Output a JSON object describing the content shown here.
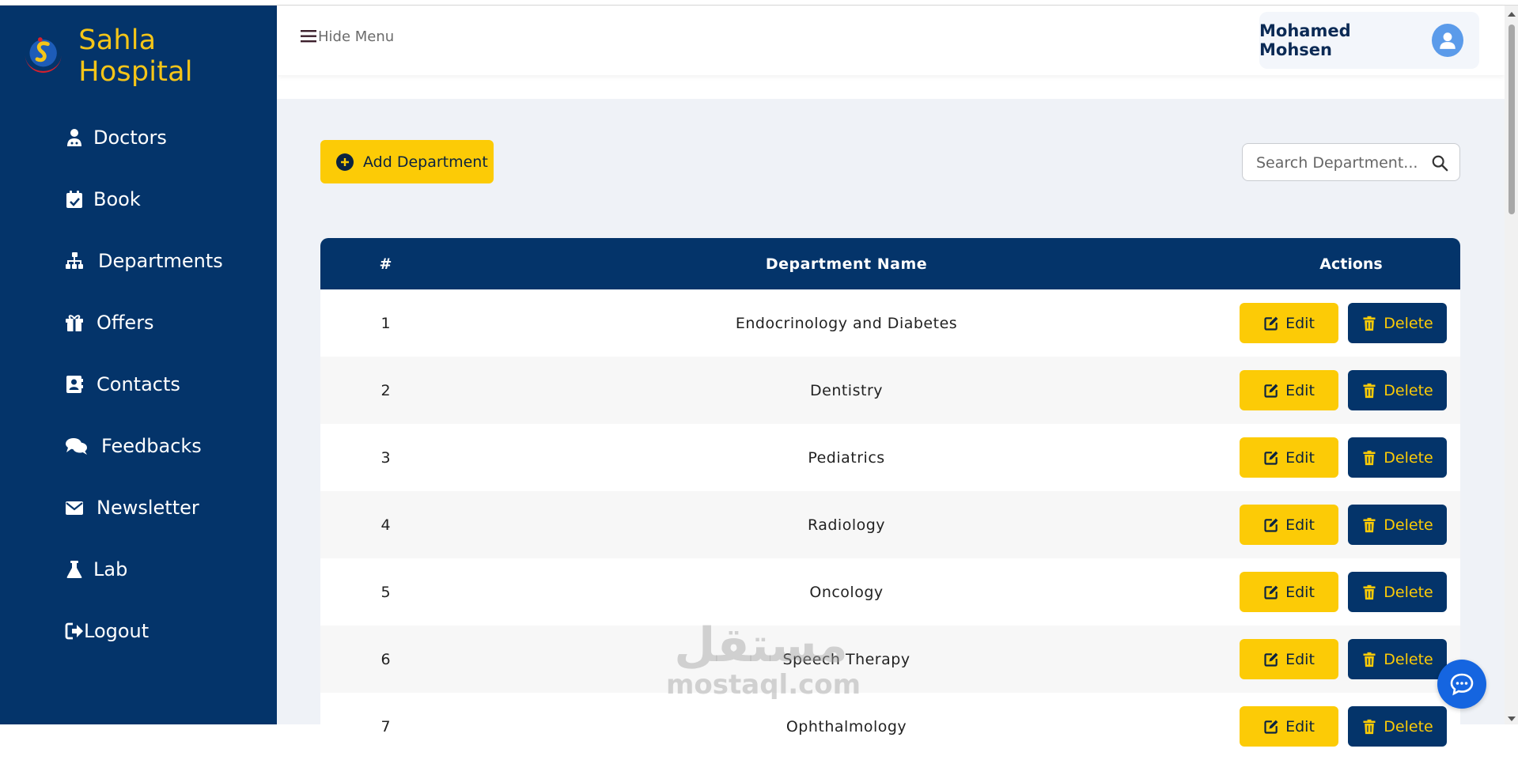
{
  "app": {
    "title": "Sahla Hospital"
  },
  "sidebar": {
    "items": [
      {
        "label": "Doctors",
        "icon": "doctor-icon"
      },
      {
        "label": "Book",
        "icon": "calendar-check-icon"
      },
      {
        "label": "Departments",
        "icon": "sitemap-icon"
      },
      {
        "label": "Offers",
        "icon": "gift-icon"
      },
      {
        "label": "Contacts",
        "icon": "address-book-icon"
      },
      {
        "label": "Feedbacks",
        "icon": "comments-icon"
      },
      {
        "label": "Newsletter",
        "icon": "envelope-icon"
      },
      {
        "label": "Lab",
        "icon": "flask-icon"
      },
      {
        "label": "Logout",
        "icon": "sign-out-icon"
      }
    ]
  },
  "header": {
    "hide_menu_label": "Hide Menu",
    "user_name": "Mohamed Mohsen"
  },
  "toolbar": {
    "add_label": "Add Department",
    "search_placeholder": "Search Department..."
  },
  "table": {
    "columns": [
      "#",
      "Department Name",
      "Actions"
    ],
    "edit_label": "Edit",
    "delete_label": "Delete",
    "rows": [
      {
        "num": "1",
        "name": "Endocrinology and Diabetes"
      },
      {
        "num": "2",
        "name": "Dentistry"
      },
      {
        "num": "3",
        "name": "Pediatrics"
      },
      {
        "num": "4",
        "name": "Radiology"
      },
      {
        "num": "5",
        "name": "Oncology"
      },
      {
        "num": "6",
        "name": "Speech Therapy"
      },
      {
        "num": "7",
        "name": "Ophthalmology"
      }
    ]
  },
  "watermark": {
    "arabic": "مستقل",
    "latin": "mostaql.com"
  },
  "colors": {
    "navy": "#04346a",
    "yellow": "#fccb06",
    "chat_blue": "#1565e0"
  }
}
